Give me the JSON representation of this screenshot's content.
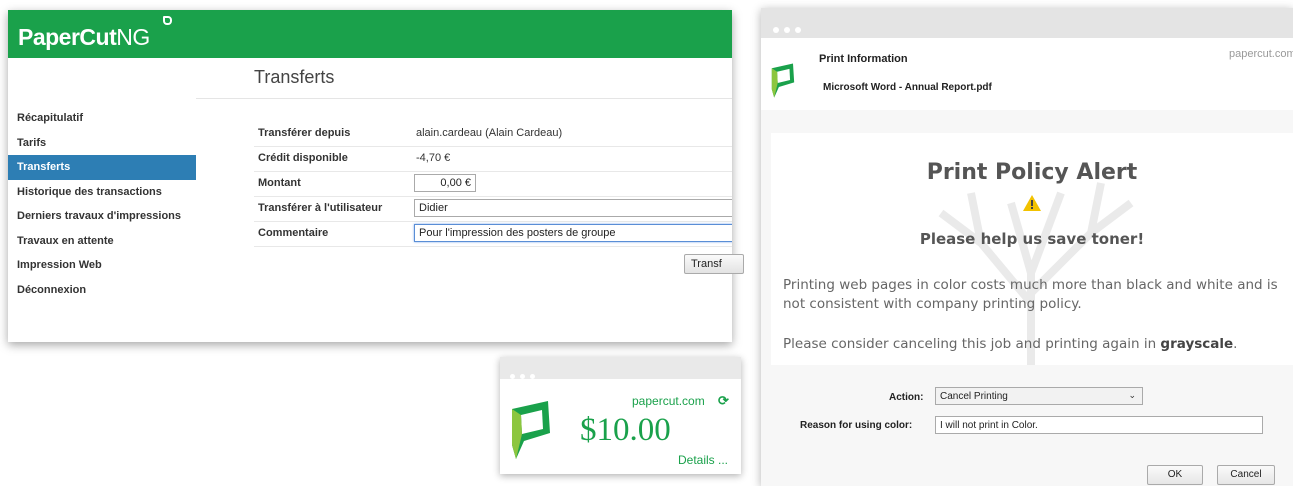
{
  "main": {
    "logo": {
      "brand": "PaperCut",
      "suffix": "NG"
    },
    "page_title": "Transferts",
    "nav": [
      {
        "label": "Récapitulatif",
        "active": false
      },
      {
        "label": "Tarifs",
        "active": false
      },
      {
        "label": "Transferts",
        "active": true
      },
      {
        "label": "Historique des transactions",
        "active": false
      },
      {
        "label": "Derniers travaux d'impressions",
        "active": false
      },
      {
        "label": "Travaux en attente",
        "active": false
      },
      {
        "label": "Impression Web",
        "active": false
      },
      {
        "label": "Déconnexion",
        "active": false
      }
    ],
    "form": {
      "from_label": "Transférer depuis",
      "from_value": "alain.cardeau (Alain Cardeau)",
      "credit_label": "Crédit disponible",
      "credit_value": "-4,70 €",
      "amount_label": "Montant",
      "amount_value": "0,00 €",
      "to_label": "Transférer à l'utilisateur",
      "to_value": "Didier",
      "comment_label": "Commentaire",
      "comment_value": "Pour l'impression des posters de groupe"
    },
    "transfer_button": "Transf"
  },
  "balance": {
    "site": "papercut.com",
    "amount": "$10.00",
    "details": "Details ..."
  },
  "print_dialog": {
    "title": "Print Information",
    "document": "Microsoft Word - Annual Report.pdf",
    "site": "papercut.com",
    "alert_title": "Print Policy Alert",
    "alert_subtitle": "Please help us save toner!",
    "paragraph1": "Printing web pages in color costs much more than black and white and is not consistent with company printing policy.",
    "paragraph2_prefix": "Please consider canceling this job and printing again in ",
    "paragraph2_bold": "grayscale",
    "paragraph2_suffix": ".",
    "action_label": "Action:",
    "action_value": "Cancel Printing",
    "reason_label": "Reason for using color:",
    "reason_value": "I will not print in Color.",
    "ok_label": "OK",
    "cancel_label": "Cancel"
  },
  "colors": {
    "brand_green": "#1aa14b",
    "nav_active": "#2d7eb4",
    "warning": "#f2c200"
  }
}
